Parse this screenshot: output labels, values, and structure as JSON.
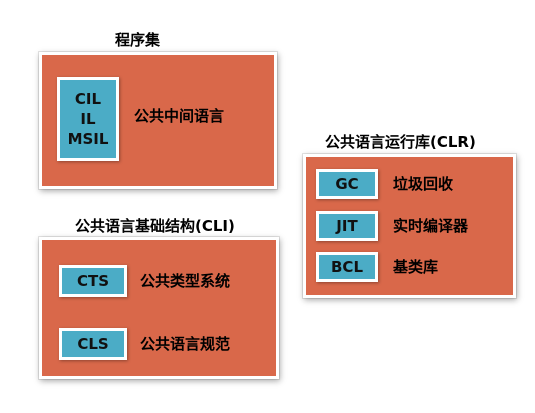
{
  "assembly": {
    "title": "程序集",
    "chip_lines": [
      "CIL",
      "IL",
      "MSIL"
    ],
    "label": "公共中间语言"
  },
  "cli": {
    "title": "公共语言基础结构(CLI)",
    "items": [
      {
        "chip": "CTS",
        "label": "公共类型系统"
      },
      {
        "chip": "CLS",
        "label": "公共语言规范"
      }
    ]
  },
  "clr": {
    "title": "公共语言运行库(CLR)",
    "items": [
      {
        "chip": "GC",
        "label": "垃圾回收"
      },
      {
        "chip": "JIT",
        "label": "实时编译器"
      },
      {
        "chip": "BCL",
        "label": "基类库"
      }
    ]
  },
  "colors": {
    "panel": "#d9684a",
    "chip": "#4bacc6"
  }
}
